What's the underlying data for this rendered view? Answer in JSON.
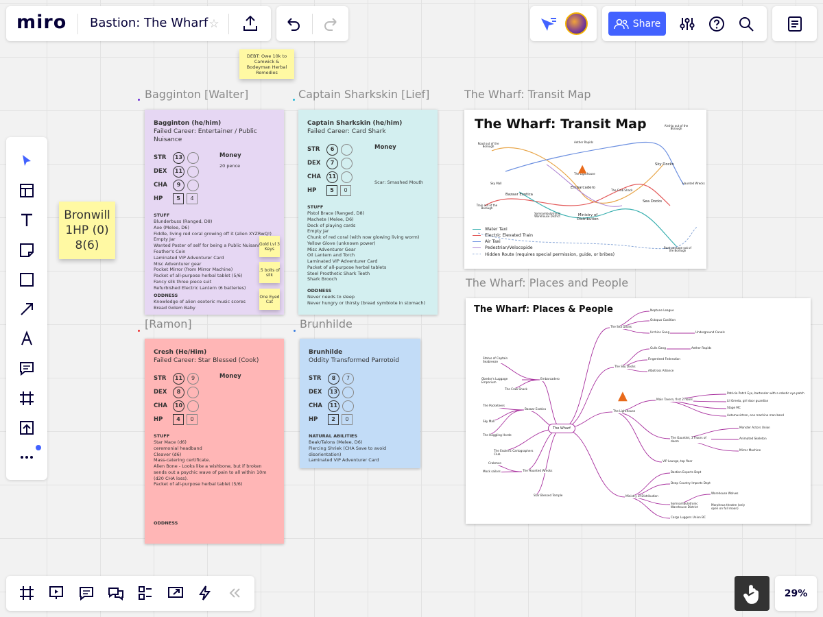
{
  "app": {
    "logo": "miro",
    "board_title": "Bastion: The Wharf",
    "zoom": "29%",
    "share_label": "Share"
  },
  "toolbar_icons": [
    "select-icon",
    "templates-icon",
    "text-icon",
    "sticky-note-icon",
    "shape-icon",
    "arrow-icon",
    "pen-icon",
    "comment-icon",
    "frame-icon",
    "upload-icon",
    "more-icon"
  ],
  "bottom_icons": [
    "frames-icon",
    "presentation-icon",
    "comments-icon",
    "chat-icon",
    "card-list-icon",
    "screen-share-icon",
    "lightning-icon",
    "collapse-icon"
  ],
  "stickies": {
    "debt": "DEBT: Owe 10k to Camwick & Bodeyman Herbal Remedies",
    "bronwill": [
      "Bronwill",
      "1HP (0)",
      "8(6)"
    ],
    "gold": "Gold Lvl 3 Keys",
    "bolts": ".5 bolts of silk",
    "eye": "One Eyed Cat"
  },
  "frames": {
    "f1": "Bagginton [Walter]",
    "f2": "Captain Sharkskin [Lief]",
    "f3": "[Ramon]",
    "f4": "Brunhilde",
    "f5": "The Wharf: Transit Map",
    "f6": "The Wharf: Places and People"
  },
  "cards": {
    "bagginton": {
      "name": "Bagginton (he/him)",
      "career": "Failed Career: Entertainer / Public Nuisance",
      "str": "13",
      "dex": "11",
      "cha": "9",
      "hp": "5",
      "hp2": "4",
      "money_label": "Money",
      "money": "20 pence",
      "stuff_label": "STUFF",
      "stuff": [
        "Blunderbuss (Ranged, D8)",
        "Axe (Melee, D6)",
        "Fiddle, living red coral growing off it (alien XYZRwQ!)",
        "Empty Jar",
        "Wanted Poster of self for being a Public Nuisance",
        "Feather's Coin",
        "Laminated VIP Adventurer Card",
        "Misc Adventurer gear",
        "Pocket Mirror (from Mirror Machine)",
        "Packet of all-purpose herbal tablet (5/6)",
        "Fancy silk three piece suit",
        "Refurbished Electric Lantern (6 batteries)"
      ],
      "odd_label": "ODDNESS",
      "odd": [
        "Knowledge of alien esoteric music scores",
        "Bread Golem Baby"
      ]
    },
    "sharkskin": {
      "name": "Captain Sharkskin (he/him)",
      "career": "Failed Career: Card Shark",
      "str": "6",
      "dex": "7",
      "cha": "11",
      "hp": "5",
      "hp2": "0",
      "money_label": "Money",
      "scar": "Scar: Smashed Mouth",
      "stuff_label": "STUFF",
      "stuff": [
        "Pistol Brace (Ranged, D8)",
        "Machete (Melee, D6)",
        "Deck of playing cards",
        "Empty Jar",
        "Chunk of red coral (with now glowing living worm)",
        "Yellow Glove (unknown power)",
        "Misc Adventurer Gear",
        "Oil Lantern and Torch",
        "Laminated VIP Adventurer Card",
        "Packet of all-purpose herbal tablets",
        "Steel Prosthetic Shark Teeth",
        "Shark Brooch"
      ],
      "odd_label": "ODDNESS",
      "odd": [
        "Never needs to sleep",
        "Never hungry or thirsty (bread symbiote in stomach)"
      ]
    },
    "cresh": {
      "name": "Cresh (He/Him)",
      "career": "Failed Career: Star Blessed (Cook)",
      "str": "11",
      "str2": "9",
      "dex": "8",
      "cha": "10",
      "hp": "4",
      "hp2": "0",
      "money_label": "Money",
      "stuff_label": "STUFF",
      "stuff": [
        "Star Mace (d6)",
        "ceremonial headband",
        "Cleaver (d6)",
        "Mass-catering certificate.",
        "Alien Bone - Looks like a wishbone, but if broken sends out a psychic wave of pain to all within 10m (d20 CHA loss).",
        "Packet of all-purpose herbal tablet (5/6)"
      ],
      "odd_label": "ODDNESS"
    },
    "brunhilde": {
      "name": "Brunhilde",
      "career": "Oddity Transformed Parrotoid",
      "str": "8",
      "str2": "7",
      "dex": "13",
      "cha": "11",
      "hp": "2",
      "hp2": "0",
      "abil_label": "NATURAL ABILITIES",
      "abil": [
        "Beak/Talons (Melee, D6)",
        "Piercing Shriek (CHA Save to avoid disorientation)",
        "Laminated VIP Adventurer Card"
      ]
    }
  },
  "transit": {
    "title": "The Wharf: Transit Map",
    "legend": [
      "Water Taxi",
      "Electric Elevated Train",
      "Air Taxi",
      "Pedestrian/Velocopide",
      "Hidden Route (requires special permission, guide, or bribes)"
    ],
    "nodes": [
      "Road out of the Borough",
      "Sky Mall",
      "Train out of the Borough",
      "Bazaar Exotica",
      "Embarcadero",
      "The Lighthouse",
      "The Crab Shack",
      "Sky Docks",
      "Sea Docks",
      "Ministry of Distribution",
      "Somnambulotronic Warehouse District",
      "Airship out of the Borough",
      "Haunted Wrecks",
      "Boat passage out of the Borough",
      "Aether Rapids"
    ]
  },
  "places": {
    "title": "The Wharf: Places & People",
    "center": "The Wharf",
    "nodes": [
      "The Sea Docks",
      "Neptune League",
      "Octopus Coalition",
      "Urchins Gang",
      "Underground Canals",
      "The Sky Docks",
      "Gulls Gang",
      "Aether Rapids",
      "Fingerdeed Federation",
      "Albatross Alliance",
      "The Lighthouse",
      "Main Tavern, first 2 floors",
      "Patricia Patch Eye, bartender with a robotic eye patch",
      "Lil Greeta, girl door guardian",
      "Stage MC",
      "Automusictron, one machine man band",
      "The Gauntlet, 3 Floors of doom",
      "Monster Actors Union",
      "Animated Skeleton",
      "Mirror Machine",
      "VIP Lounge, top floor",
      "Ministry of Distribution",
      "Bastion Exports Dept",
      "Deep Country Imports Dept",
      "Somnambulotronic Warehouse District",
      "Warehouse Wolves",
      "Morpheus theatre (only open on full moon)",
      "Cargo Luggers Union BC",
      "Embarcadero",
      "Status of Captain Seabreeze",
      "Obedor's Luggage Emporium",
      "The Crab Shack",
      "Bazaar Exotica",
      "The Pocketeers",
      "Sky Mall",
      "The Haggling Horde",
      "The Esoteric Cartographers Club",
      "The Haunted Wrecks",
      "Crabmen",
      "Mock sailors",
      "Star Blessed Temple"
    ]
  },
  "colors": {
    "accent": "#4262ff",
    "pink": "#ffb6b6",
    "purple": "#e6d7f3",
    "teal": "#d3eff0",
    "blue": "#c2dcf7",
    "sticky": "#fff9a3",
    "mindmap": "#a8309e"
  }
}
